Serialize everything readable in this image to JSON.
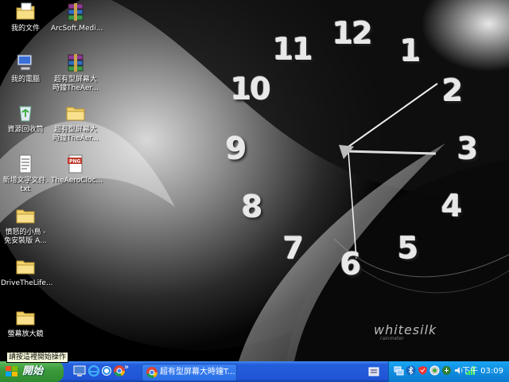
{
  "desktop_icons": [
    {
      "label": "我的文件",
      "icon": "my-documents-icon"
    },
    {
      "label": "我的電腦",
      "icon": "my-computer-icon"
    },
    {
      "label": "資源回收筒",
      "icon": "recycle-bin-icon"
    },
    {
      "label": "新增文字文件.\ntxt",
      "icon": "text-file-icon"
    },
    {
      "label": "憤怒的小鳥 -\n免安裝版 A...",
      "icon": "folder-icon"
    },
    {
      "label": "DriveTheLife...",
      "icon": "folder-icon"
    },
    {
      "label": "螢幕放大鏡",
      "icon": "folder-icon"
    },
    {
      "label": "ArcSoft.Medi...",
      "icon": "winrar-archive-icon"
    },
    {
      "label": "超有型屏幕大\n時鐘TheAer...",
      "icon": "winrar-archive-icon"
    },
    {
      "label": "超有型屏幕大\n時鐘TheAer...",
      "icon": "folder-icon"
    },
    {
      "label": "TheAeroCloc...",
      "icon": "png-file-icon"
    }
  ],
  "clock": {
    "numbers": [
      "12",
      "1",
      "2",
      "3",
      "4",
      "5",
      "6",
      "7",
      "8",
      "9",
      "10",
      "11"
    ],
    "brand": "whitesilk",
    "brand_sub": "rainmeter"
  },
  "tooltip": "請按這裡開始操作",
  "taskbar": {
    "start_label": "開始",
    "quicklaunch": [
      "show-desktop-icon",
      "internet-explorer-icon",
      "ie-alt-icon",
      "chrome-icon"
    ],
    "chevron": "»",
    "task_title": "超有型屏幕大時鐘T...",
    "task_icon": "chrome-icon",
    "tray_icons": [
      "network-icon",
      "bluetooth-icon",
      "security-icon",
      "antivirus-icon",
      "update-icon",
      "volume-icon",
      "signal-icon"
    ],
    "clock_text": "下午 03:09"
  },
  "colors": {
    "taskbar": "#245edb",
    "start": "#3c9b3c",
    "tray": "#0f8de0"
  }
}
